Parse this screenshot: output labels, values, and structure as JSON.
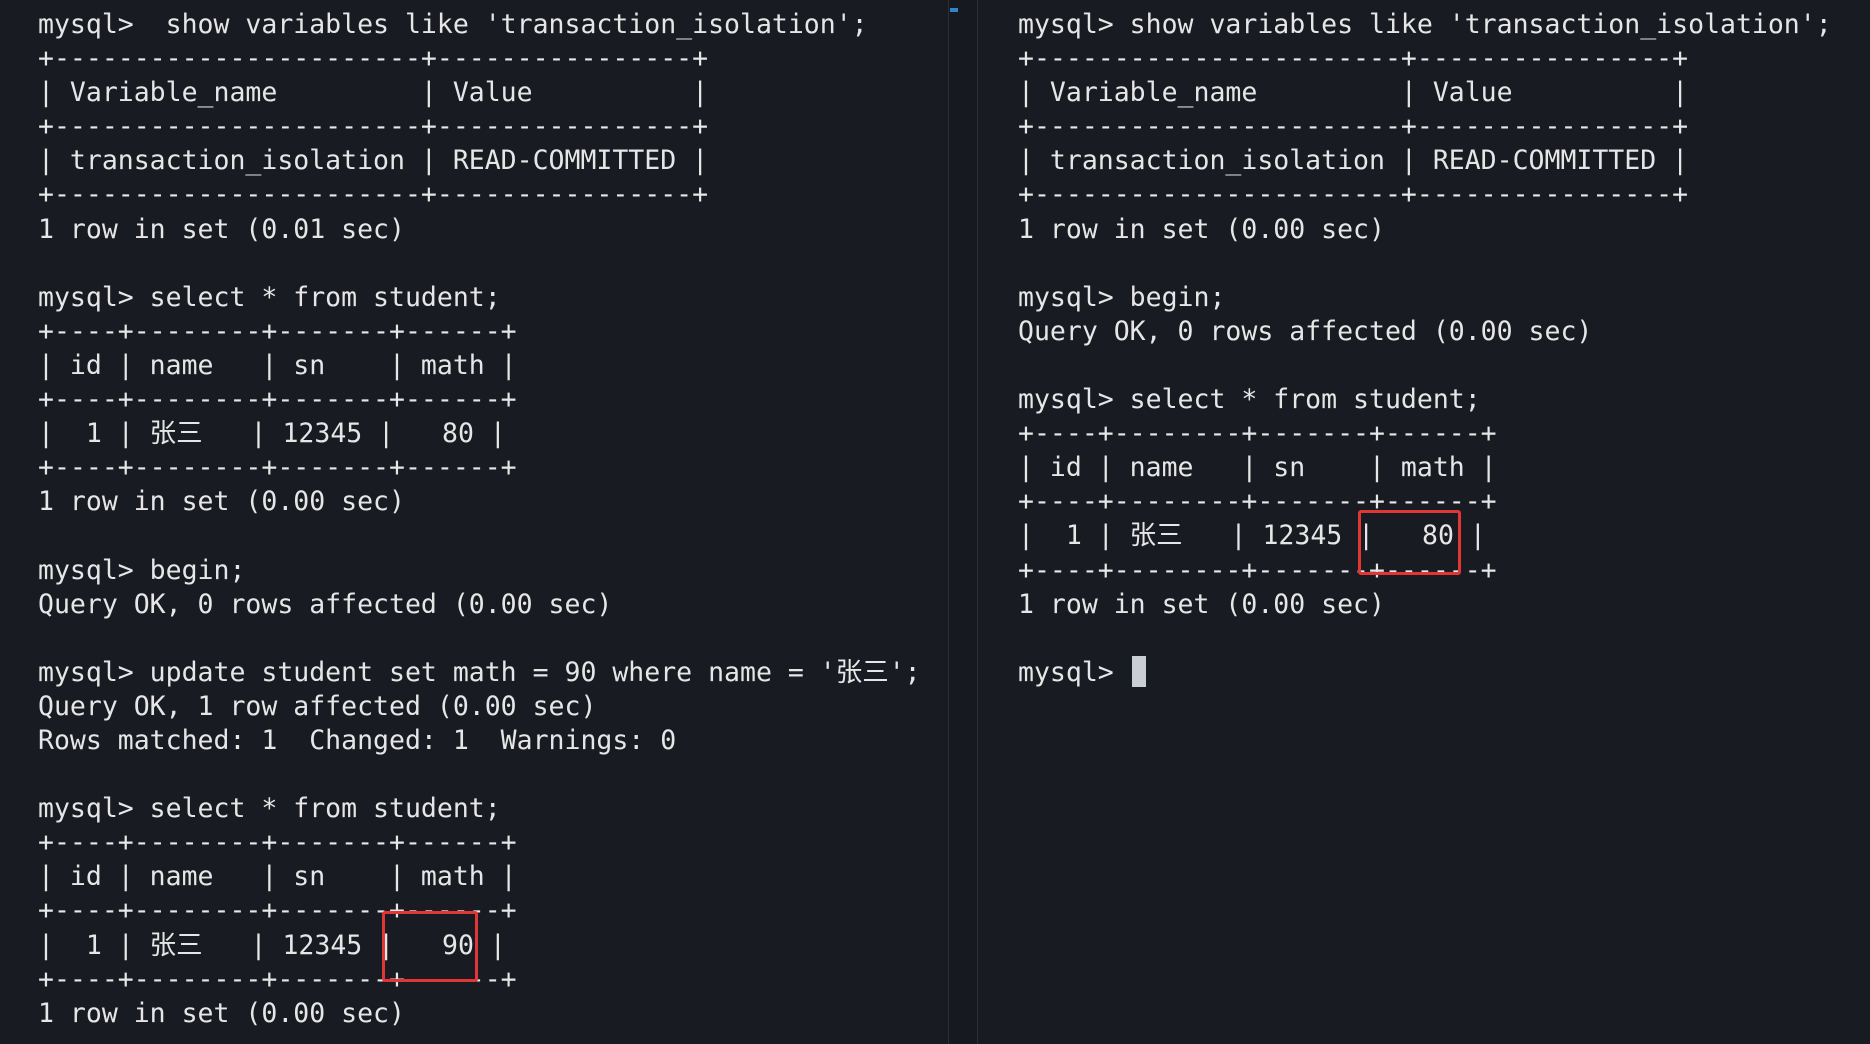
{
  "left_terminal": {
    "lines": [
      "mysql>  show variables like 'transaction_isolation';",
      "+-----------------------+----------------+",
      "| Variable_name         | Value          |",
      "+-----------------------+----------------+",
      "| transaction_isolation | READ-COMMITTED |",
      "+-----------------------+----------------+",
      "1 row in set (0.01 sec)",
      "",
      "mysql> select * from student;",
      "+----+--------+-------+------+",
      "| id | name   | sn    | math |",
      "+----+--------+-------+------+",
      "|  1 | 张三   | 12345 |   80 |",
      "+----+--------+-------+------+",
      "1 row in set (0.00 sec)",
      "",
      "mysql> begin;",
      "Query OK, 0 rows affected (0.00 sec)",
      "",
      "mysql> update student set math = 90 where name = '张三';",
      "Query OK, 1 row affected (0.00 sec)",
      "Rows matched: 1  Changed: 1  Warnings: 0",
      "",
      "mysql> select * from student;",
      "+----+--------+-------+------+",
      "| id | name   | sn    | math |",
      "+----+--------+-------+------+",
      "|  1 | 张三   | 12345 |   90 |",
      "+----+--------+-------+------+",
      "1 row in set (0.00 sec)"
    ]
  },
  "right_terminal": {
    "lines": [
      "mysql> show variables like 'transaction_isolation';",
      "+-----------------------+----------------+",
      "| Variable_name         | Value          |",
      "+-----------------------+----------------+",
      "| transaction_isolation | READ-COMMITTED |",
      "+-----------------------+----------------+",
      "1 row in set (0.00 sec)",
      "",
      "mysql> begin;",
      "Query OK, 0 rows affected (0.00 sec)",
      "",
      "mysql> select * from student;",
      "+----+--------+-------+------+",
      "| id | name   | sn    | math |",
      "+----+--------+-------+------+",
      "|  1 | 张三   | 12345 |   80 |",
      "+----+--------+-------+------+",
      "1 row in set (0.00 sec)",
      ""
    ],
    "prompt": "mysql> "
  },
  "colors": {
    "background": "#181b21",
    "text": "#e6e6e6",
    "highlight": "#e23535",
    "cursor": "#c9cdd4",
    "divider_marker": "#2e86c9"
  }
}
